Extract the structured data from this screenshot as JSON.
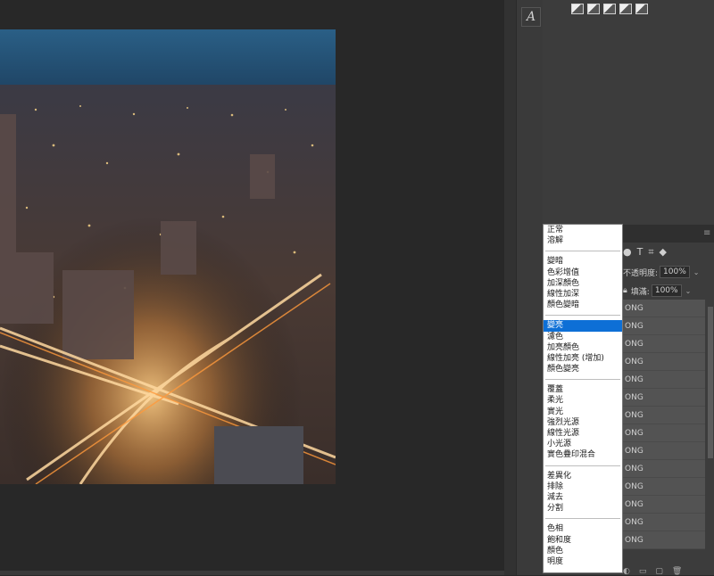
{
  "tools": {
    "type_tool_glyph": "A"
  },
  "options_bar": {
    "icons": [
      "warp-text-icon",
      "warp-text-icon",
      "warp-text-icon",
      "character-panel-icon",
      "paragraph-panel-icon"
    ]
  },
  "layers_panel": {
    "opacity_label": "不透明度:",
    "opacity_value": "100%",
    "fill_label": "填滿:",
    "fill_value": "100%",
    "filter_icons": [
      "●",
      "T",
      "⌗",
      "◆"
    ],
    "layers": [
      "ONG",
      "ONG",
      "ONG",
      "ONG",
      "ONG",
      "ONG",
      "ONG",
      "ONG",
      "ONG",
      "ONG",
      "ONG",
      "ONG",
      "ONG",
      "ONG"
    ]
  },
  "blend_menu": {
    "groups": [
      [
        "正常",
        "溶解"
      ],
      [
        "變暗",
        "色彩增值",
        "加深顏色",
        "線性加深",
        "顏色變暗"
      ],
      [
        "變亮",
        "濾色",
        "加亮顏色",
        "線性加亮 (增加)",
        "顏色變亮"
      ],
      [
        "覆蓋",
        "柔光",
        "實光",
        "強烈光源",
        "線性光源",
        "小光源",
        "實色疊印混合"
      ],
      [
        "差異化",
        "排除",
        "減去",
        "分割"
      ],
      [
        "色相",
        "飽和度",
        "顏色",
        "明度"
      ]
    ],
    "selected": "變亮"
  }
}
